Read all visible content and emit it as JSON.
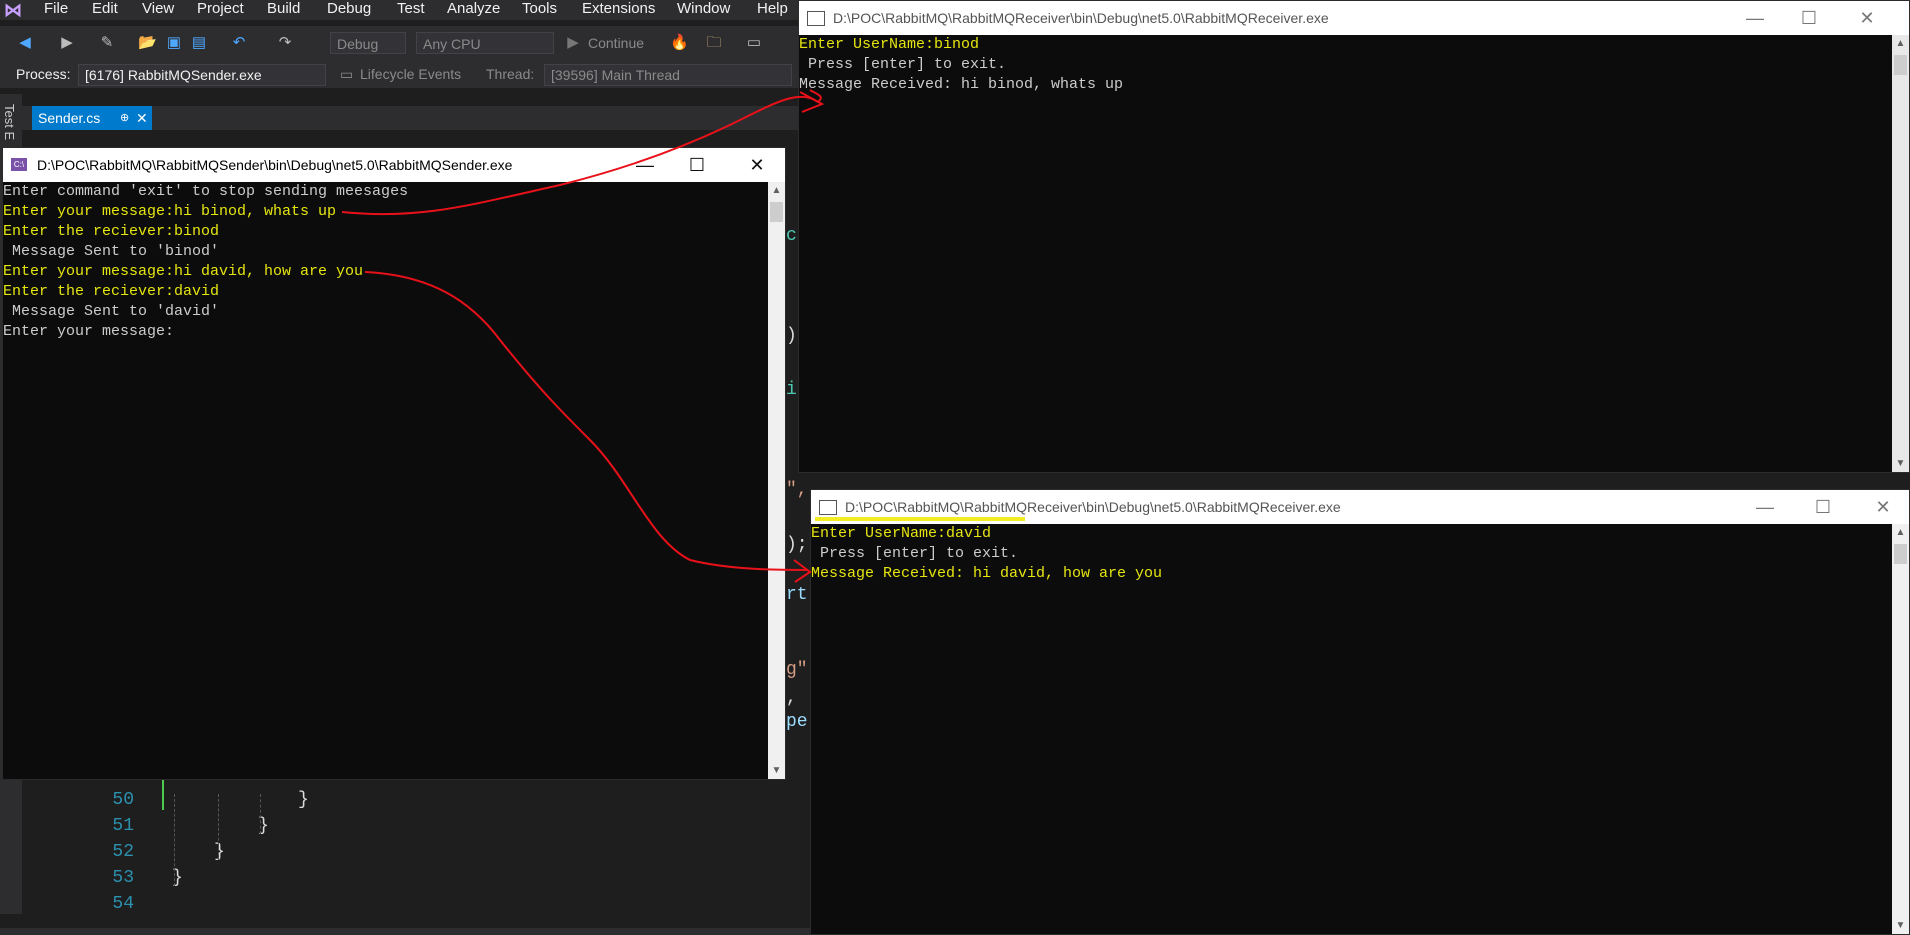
{
  "vs": {
    "menu": [
      "File",
      "Edit",
      "View",
      "Project",
      "Build",
      "Debug",
      "Test",
      "Analyze",
      "Tools",
      "Extensions",
      "Window",
      "Help"
    ],
    "toolbar": {
      "config": "Debug",
      "platform": "Any CPU",
      "continue_label": "Continue"
    },
    "process_label": "Process:",
    "process_value": "[6176] RabbitMQSender.exe",
    "lifecycle_label": "Lifecycle Events",
    "thread_label": "Thread:",
    "thread_value": "[39596] Main Thread",
    "side_label": "Test E",
    "tab": "Sender.cs",
    "code_lines": [
      {
        "no": "50",
        "text": "}"
      },
      {
        "no": "51",
        "text": "}"
      },
      {
        "no": "52",
        "text": "}"
      },
      {
        "no": "53",
        "text": "}"
      },
      {
        "no": "54",
        "text": ""
      }
    ],
    "code_fragments": [
      "ct",
      ")",
      "i",
      "\",",
      ");",
      "rt",
      "g\"",
      ",",
      "pe"
    ]
  },
  "sender_window": {
    "title": "D:\\POC\\RabbitMQ\\RabbitMQSender\\bin\\Debug\\net5.0\\RabbitMQSender.exe",
    "lines": [
      {
        "text": "Enter command 'exit' to stop sending meesages",
        "color": "white"
      },
      {
        "text": "Enter your message:hi binod, whats up",
        "color": "yellow"
      },
      {
        "text": "Enter the reciever:binod",
        "color": "yellow"
      },
      {
        "text": " Message Sent to 'binod'",
        "color": "white"
      },
      {
        "text": "Enter your message:hi david, how are you",
        "color": "yellow"
      },
      {
        "text": "Enter the reciever:david",
        "color": "yellow"
      },
      {
        "text": " Message Sent to 'david'",
        "color": "white"
      },
      {
        "text": "Enter your message:",
        "color": "white"
      }
    ]
  },
  "receiver_binod": {
    "title": "D:\\POC\\RabbitMQ\\RabbitMQReceiver\\bin\\Debug\\net5.0\\RabbitMQReceiver.exe",
    "lines": [
      {
        "text": "Enter UserName:binod",
        "color": "yellow"
      },
      {
        "text": " Press [enter] to exit.",
        "color": "white"
      },
      {
        "text": "Message Received: hi binod, whats up",
        "color": "white"
      }
    ]
  },
  "receiver_david": {
    "title": "D:\\POC\\RabbitMQ\\RabbitMQReceiver\\bin\\Debug\\net5.0\\RabbitMQReceiver.exe",
    "lines": [
      {
        "text": "Enter UserName:david",
        "color": "yellow"
      },
      {
        "text": " Press [enter] to exit.",
        "color": "white"
      },
      {
        "text": "Message Received: hi david, how are you",
        "color": "yellow"
      }
    ]
  },
  "colors": {
    "accent": "#007acc",
    "console_bg": "#0c0c0c",
    "console_text": "#cccccc",
    "console_yellow": "#e5e510",
    "annotation": "#e8111a"
  }
}
